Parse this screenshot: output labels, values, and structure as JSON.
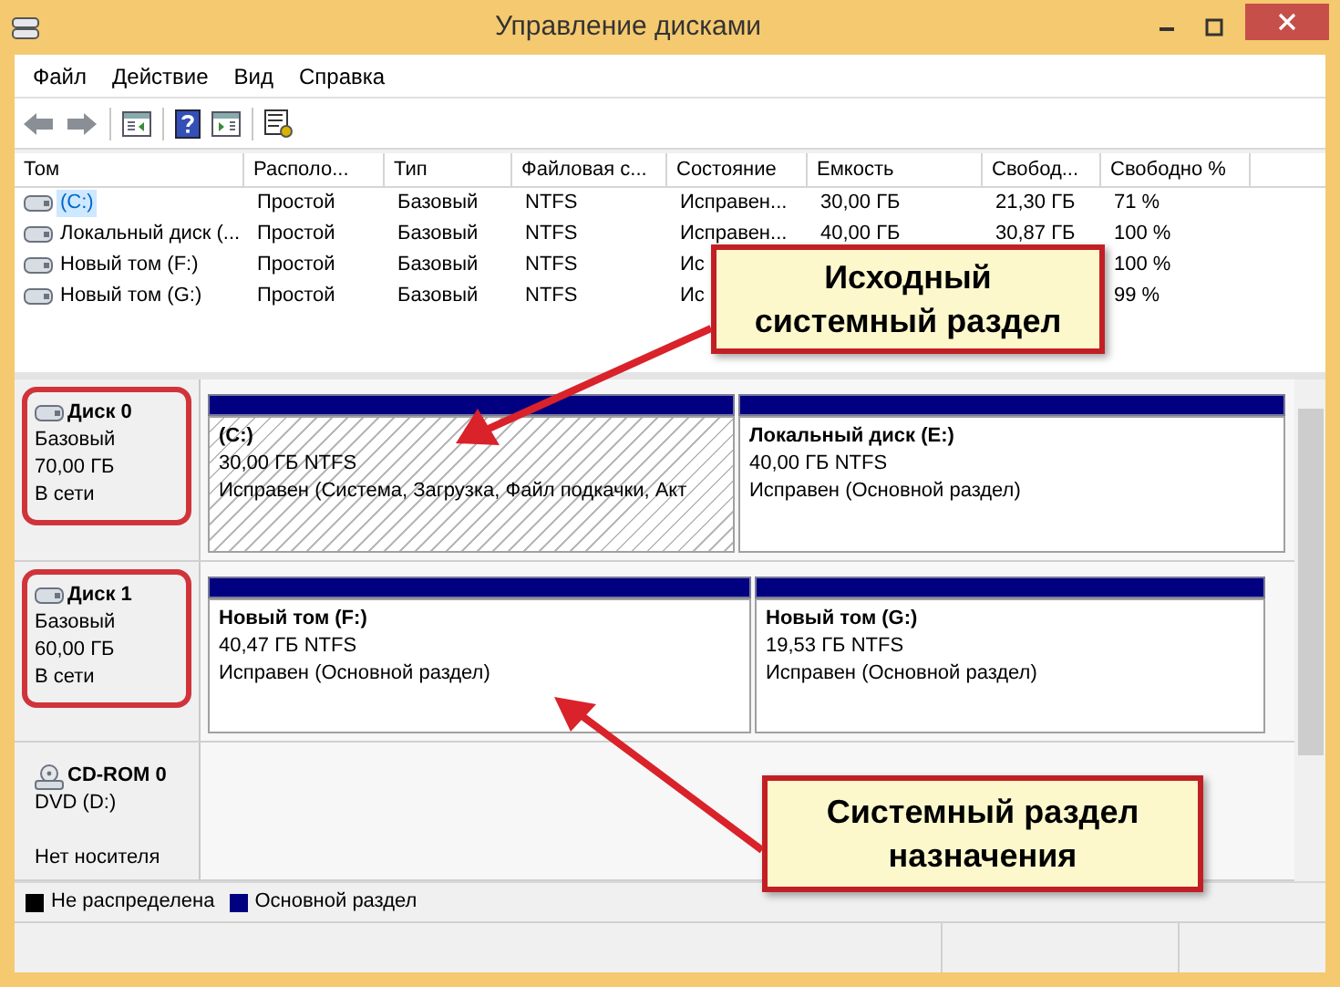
{
  "window": {
    "title": "Управление дисками"
  },
  "menu": [
    "Файл",
    "Действие",
    "Вид",
    "Справка"
  ],
  "table": {
    "columns": [
      "Том",
      "Располо...",
      "Тип",
      "Файловая с...",
      "Состояние",
      "Емкость",
      "Свобод...",
      "Свободно %"
    ],
    "rows": [
      {
        "selected": true,
        "cells": [
          "(C:)",
          "Простой",
          "Базовый",
          "NTFS",
          "Исправен...",
          "30,00 ГБ",
          "21,30 ГБ",
          "71 %"
        ]
      },
      {
        "selected": false,
        "cells": [
          "Локальный диск (...",
          "Простой",
          "Базовый",
          "NTFS",
          "Исправен...",
          "40,00 ГБ",
          "30,87 ГБ",
          "100 %"
        ]
      },
      {
        "selected": false,
        "cells": [
          "Новый том (F:)",
          "Простой",
          "Базовый",
          "NTFS",
          "Ис",
          "",
          "",
          "100 %"
        ]
      },
      {
        "selected": false,
        "cells": [
          "Новый том (G:)",
          "Простой",
          "Базовый",
          "NTFS",
          "Ис",
          "",
          "",
          "99 %"
        ]
      }
    ]
  },
  "disks": [
    {
      "kind": "disk",
      "name": "Диск 0",
      "type": "Базовый",
      "size": "70,00 ГБ",
      "status": "В сети",
      "highlighted": true,
      "partitions": [
        {
          "label": "(C:)",
          "size": "30,00 ГБ NTFS",
          "status": "Исправен (Система, Загрузка, Файл подкачки, Акт",
          "hatched": true
        },
        {
          "label": "Локальный диск  (E:)",
          "size": "40,00 ГБ NTFS",
          "status": "Исправен (Основной раздел)",
          "hatched": false
        }
      ]
    },
    {
      "kind": "disk",
      "name": "Диск 1",
      "type": "Базовый",
      "size": "60,00 ГБ",
      "status": "В сети",
      "highlighted": true,
      "partitions": [
        {
          "label": "Новый том  (F:)",
          "size": "40,47 ГБ NTFS",
          "status": "Исправен (Основной раздел)",
          "hatched": false
        },
        {
          "label": "Новый том  (G:)",
          "size": "19,53 ГБ NTFS",
          "status": "Исправен (Основной раздел)",
          "hatched": false
        }
      ]
    },
    {
      "kind": "cdrom",
      "name": "CD-ROM 0",
      "type": "DVD (D:)",
      "status": "Нет носителя",
      "highlighted": false
    }
  ],
  "legend": [
    {
      "label": "Не распределена",
      "color": "#000000"
    },
    {
      "label": "Основной раздел",
      "color": "#000080"
    }
  ],
  "annotations": [
    {
      "lines": [
        "Исходный",
        "системный раздел"
      ]
    },
    {
      "lines": [
        "Системный раздел",
        "назначения"
      ]
    }
  ]
}
